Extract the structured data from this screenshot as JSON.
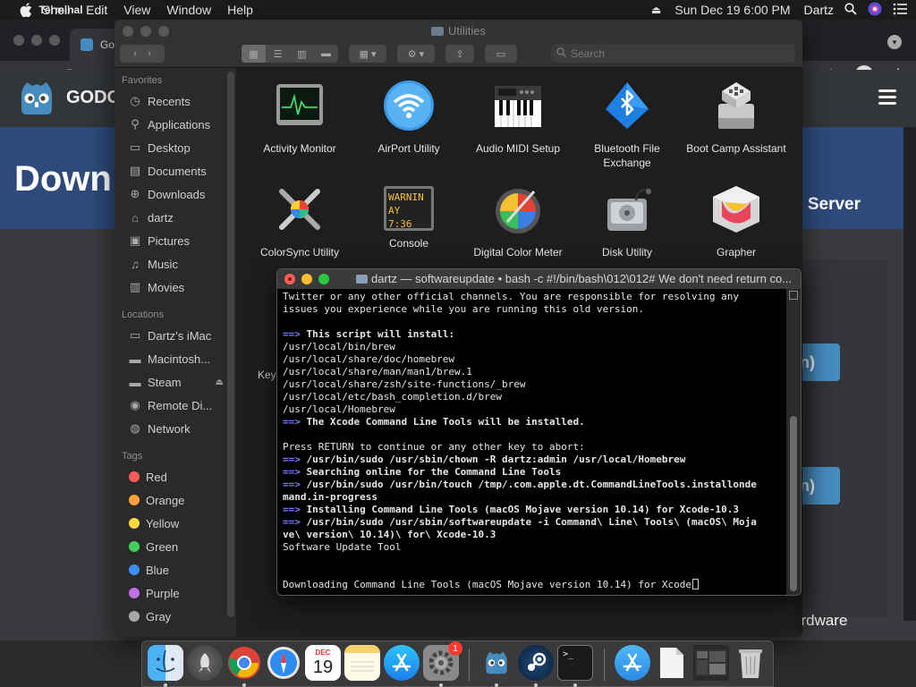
{
  "menubar": {
    "app_name": "Terminal",
    "menus": [
      "Shell",
      "Edit",
      "View",
      "Window",
      "Help"
    ],
    "clock": "Sun Dec 19  6:00 PM",
    "user": "Dartz"
  },
  "browser": {
    "tab_title": "Go",
    "page": {
      "brand": "GODO",
      "hero_title": "Down",
      "hero_right": "Server",
      "button_text_1": "n)",
      "button_text_2": "n)",
      "footer_text": "ardware"
    }
  },
  "finder": {
    "title": "Utilities",
    "search_placeholder": "Search",
    "sections": {
      "favorites": "Favorites",
      "locations": "Locations",
      "tags": "Tags"
    },
    "favorites": [
      {
        "label": "Recents",
        "icon": "clock-icon"
      },
      {
        "label": "Applications",
        "icon": "applications-icon"
      },
      {
        "label": "Desktop",
        "icon": "desktop-icon"
      },
      {
        "label": "Documents",
        "icon": "document-icon"
      },
      {
        "label": "Downloads",
        "icon": "download-icon"
      },
      {
        "label": "dartz",
        "icon": "home-icon"
      },
      {
        "label": "Pictures",
        "icon": "camera-icon"
      },
      {
        "label": "Music",
        "icon": "music-icon"
      },
      {
        "label": "Movies",
        "icon": "film-icon"
      }
    ],
    "locations": [
      {
        "label": "Dartz’s iMac",
        "icon": "imac-icon"
      },
      {
        "label": "Macintosh...",
        "icon": "harddisk-icon"
      },
      {
        "label": "Steam",
        "icon": "drive-icon"
      },
      {
        "label": "Remote Di...",
        "icon": "disc-icon"
      },
      {
        "label": "Network",
        "icon": "globe-icon"
      }
    ],
    "tags": [
      {
        "label": "Red",
        "color": "#ff5b58"
      },
      {
        "label": "Orange",
        "color": "#ffa03b"
      },
      {
        "label": "Yellow",
        "color": "#ffd83b"
      },
      {
        "label": "Green",
        "color": "#3fd15a"
      },
      {
        "label": "Blue",
        "color": "#3f8ef5"
      },
      {
        "label": "Purple",
        "color": "#c470e8"
      },
      {
        "label": "Gray",
        "color": "#a8a8a8"
      }
    ],
    "apps_row1": [
      "Activity Monitor",
      "AirPort Utility",
      "Audio MIDI Setup",
      "Bluetooth File Exchange",
      "Boot Camp Assistant"
    ],
    "apps_row2": [
      "ColorSync Utility",
      "Console",
      "Digital Color Meter",
      "Disk Utility",
      "Grapher"
    ],
    "console_icon_text": [
      "WARNIN",
      "AY 7:36"
    ],
    "partial_label": "Key"
  },
  "terminal": {
    "title": "dartz — softwareupdate • bash -c #!/bin/bash\\012\\012# We don't need return co...",
    "lines": [
      {
        "arrow": false,
        "text": "Twitter or any other official channels. You are responsible for resolving any",
        "bold": false
      },
      {
        "arrow": false,
        "text": "issues you experience while you are running this old version.",
        "bold": false
      },
      {
        "arrow": false,
        "text": "",
        "bold": false
      },
      {
        "arrow": true,
        "text": "This script will install:",
        "bold": true
      },
      {
        "arrow": false,
        "text": "/usr/local/bin/brew",
        "bold": false
      },
      {
        "arrow": false,
        "text": "/usr/local/share/doc/homebrew",
        "bold": false
      },
      {
        "arrow": false,
        "text": "/usr/local/share/man/man1/brew.1",
        "bold": false
      },
      {
        "arrow": false,
        "text": "/usr/local/share/zsh/site-functions/_brew",
        "bold": false
      },
      {
        "arrow": false,
        "text": "/usr/local/etc/bash_completion.d/brew",
        "bold": false
      },
      {
        "arrow": false,
        "text": "/usr/local/Homebrew",
        "bold": false
      },
      {
        "arrow": true,
        "text": "The Xcode Command Line Tools will be installed.",
        "bold": true
      },
      {
        "arrow": false,
        "text": "",
        "bold": false
      },
      {
        "arrow": false,
        "text": "Press RETURN to continue or any other key to abort:",
        "bold": false
      },
      {
        "arrow": true,
        "text": "/usr/bin/sudo /usr/sbin/chown -R dartz:admin /usr/local/Homebrew",
        "bold": true
      },
      {
        "arrow": true,
        "text": "Searching online for the Command Line Tools",
        "bold": true
      },
      {
        "arrow": true,
        "text": "/usr/bin/sudo /usr/bin/touch /tmp/.com.apple.dt.CommandLineTools.installonde",
        "bold": true
      },
      {
        "arrow": false,
        "text": "mand.in-progress",
        "bold": true
      },
      {
        "arrow": true,
        "text": "Installing Command Line Tools (macOS Mojave version 10.14) for Xcode-10.3",
        "bold": true
      },
      {
        "arrow": true,
        "text": "/usr/bin/sudo /usr/sbin/softwareupdate -i Command\\ Line\\ Tools\\ (macOS\\ Moja",
        "bold": true
      },
      {
        "arrow": false,
        "text": "ve\\ version\\ 10.14)\\ for\\ Xcode-10.3",
        "bold": true
      },
      {
        "arrow": false,
        "text": "Software Update Tool",
        "bold": false
      },
      {
        "arrow": false,
        "text": "",
        "bold": false
      },
      {
        "arrow": false,
        "text": "",
        "bold": false
      },
      {
        "arrow": false,
        "text": "Downloading Command Line Tools (macOS Mojave version 10.14) for Xcode",
        "bold": false,
        "cursor": true
      }
    ],
    "arrow_glyph": "==>"
  },
  "dock": {
    "items": [
      {
        "name": "finder",
        "icon": "finder-icon",
        "running": true
      },
      {
        "name": "launchpad",
        "icon": "launchpad-icon",
        "running": false
      },
      {
        "name": "chrome",
        "icon": "chrome-icon",
        "running": true
      },
      {
        "name": "safari",
        "icon": "safari-icon",
        "running": false
      },
      {
        "name": "calendar",
        "icon": "calendar-icon",
        "running": false,
        "month": "DEC",
        "day": "19"
      },
      {
        "name": "notes",
        "icon": "notes-icon",
        "running": false
      },
      {
        "name": "app-store",
        "icon": "app-store-icon",
        "running": false
      },
      {
        "name": "system-preferences",
        "icon": "gear-icon",
        "running": true,
        "badge": "1"
      },
      {
        "name": "godot",
        "icon": "godot-icon",
        "running": true
      },
      {
        "name": "steam",
        "icon": "steam-icon",
        "running": true
      },
      {
        "name": "terminal",
        "icon": "terminal-icon",
        "running": true,
        "prompt": ">_"
      },
      {
        "name": "applications-folder",
        "icon": "app-store-folder-icon",
        "running": false
      },
      {
        "name": "document",
        "icon": "document-stack-icon",
        "running": false
      },
      {
        "name": "downloads-stack",
        "icon": "screenshot-stack-icon",
        "running": false
      },
      {
        "name": "trash",
        "icon": "trash-icon",
        "running": false
      }
    ]
  }
}
